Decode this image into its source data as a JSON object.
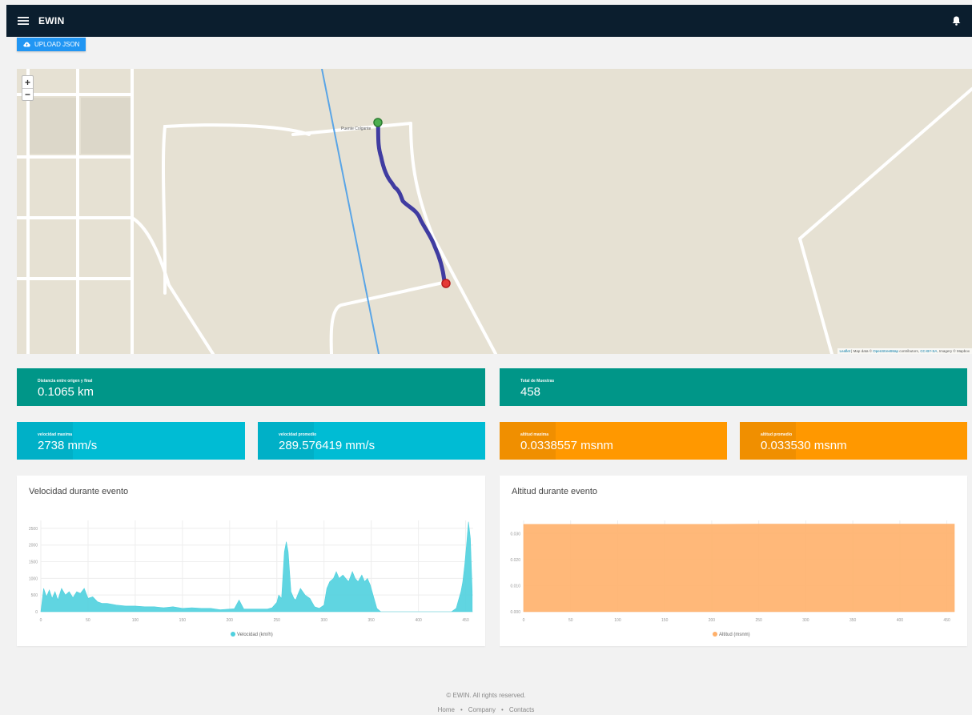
{
  "header": {
    "app_name": "EWIN",
    "menu_icon": "hamburger-icon",
    "bell_icon": "bell-icon"
  },
  "toolbar": {
    "upload_label": "UPLOAD JSON",
    "upload_icon": "cloud-upload-icon"
  },
  "map": {
    "zoom_in": "+",
    "zoom_out": "−",
    "street_label": "Puente Colgante",
    "attribution": {
      "leaflet": "Leaflet",
      "prefix": " | Map data © ",
      "osm": "OpenStreetMap",
      "middle": " contributors, ",
      "license": "CC-BY-SA",
      "suffix": ", Imagery © Mapbox"
    },
    "start_marker_color": "#4caf50",
    "end_marker_color": "#e53935",
    "route_color": "#2d2a9b"
  },
  "stats": {
    "distance": {
      "label": "Distancia entre origen y final",
      "value": "0.1065 km"
    },
    "samples": {
      "label": "Total de Muestras",
      "value": "458"
    },
    "max_speed": {
      "label": "velocidad maxima",
      "value": "2738 mm/s"
    },
    "avg_speed": {
      "label": "velocidad promedio",
      "value": "289.576419 mm/s"
    },
    "max_altitude": {
      "label": "altitud maxima",
      "value": "0.0338557 msnm"
    },
    "avg_altitude": {
      "label": "altitud promedio",
      "value": "0.033530 msnm"
    }
  },
  "colors": {
    "teal": "#009688",
    "cyan": "#00bcd4",
    "orange": "#ff9800",
    "navbar": "#0b1e2e",
    "upload": "#2196f3"
  },
  "charts": {
    "speed": {
      "title": "Velocidad durante evento"
    },
    "altitude": {
      "title": "Altitud durante evento"
    }
  },
  "chart_data": [
    {
      "type": "area",
      "title": "Velocidad durante evento",
      "series": [
        {
          "name": "Velocidad (km/h)",
          "color": "#4fd0de",
          "x": [
            0,
            3,
            6,
            9,
            12,
            15,
            18,
            22,
            26,
            30,
            34,
            38,
            42,
            46,
            50,
            55,
            60,
            65,
            70,
            80,
            90,
            100,
            110,
            120,
            130,
            140,
            150,
            160,
            170,
            180,
            190,
            200,
            205,
            210,
            215,
            220,
            230,
            240,
            245,
            250,
            252,
            255,
            258,
            260,
            262,
            265,
            268,
            270,
            272,
            275,
            280,
            285,
            290,
            295,
            300,
            303,
            306,
            310,
            313,
            316,
            320,
            323,
            326,
            330,
            333,
            336,
            340,
            343,
            346,
            349,
            352,
            356,
            360,
            370,
            380,
            390,
            400,
            410,
            420,
            430,
            435,
            440,
            442,
            445,
            447,
            449,
            451,
            453,
            455,
            457
          ],
          "values": [
            0,
            700,
            450,
            650,
            400,
            600,
            350,
            700,
            500,
            600,
            420,
            600,
            550,
            700,
            400,
            450,
            300,
            250,
            250,
            200,
            170,
            170,
            150,
            150,
            120,
            150,
            100,
            120,
            100,
            100,
            60,
            80,
            90,
            350,
            80,
            80,
            80,
            80,
            120,
            280,
            500,
            400,
            1800,
            2100,
            1800,
            600,
            400,
            350,
            500,
            700,
            500,
            400,
            150,
            100,
            200,
            700,
            900,
            1000,
            1200,
            1000,
            1100,
            1000,
            900,
            1200,
            1000,
            900,
            1100,
            900,
            1000,
            800,
            500,
            100,
            0,
            0,
            0,
            0,
            0,
            0,
            0,
            0,
            0,
            100,
            300,
            600,
            900,
            1400,
            2000,
            2700,
            2200,
            600
          ]
        }
      ],
      "xlim": [
        0,
        458
      ],
      "ylim": [
        0,
        2738
      ],
      "xticks": [
        0,
        50,
        100,
        150,
        200,
        250,
        300,
        350,
        400,
        450
      ],
      "yticks": [
        0,
        500,
        1000,
        1500,
        2000,
        2500
      ],
      "legend": "bottom"
    },
    {
      "type": "area",
      "title": "Altitud durante evento",
      "series": [
        {
          "name": "Altitud (msnm)",
          "color": "#ffb06a",
          "x": [
            0,
            50,
            100,
            150,
            200,
            250,
            300,
            350,
            400,
            450,
            458
          ],
          "values": [
            0.0335,
            0.0335,
            0.0335,
            0.0335,
            0.0335,
            0.0336,
            0.0336,
            0.0336,
            0.0336,
            0.0336,
            0.0336
          ]
        }
      ],
      "xlim": [
        0,
        458
      ],
      "ylim": [
        0,
        0.035
      ],
      "xticks": [
        0,
        50,
        100,
        150,
        200,
        250,
        300,
        350,
        400,
        450
      ],
      "yticks": [
        {
          "value": 0,
          "label": "0.000"
        },
        {
          "value": 0.01,
          "label": "0.010"
        },
        {
          "value": 0.02,
          "label": "0.020"
        },
        {
          "value": 0.03,
          "label": "0.030"
        }
      ],
      "legend": "bottom"
    }
  ],
  "footer": {
    "copyright": "© EWIN. All rights reserved.",
    "links": [
      {
        "label": "Home"
      },
      {
        "label": "Company"
      },
      {
        "label": "Contacts"
      }
    ],
    "separator": "•"
  }
}
